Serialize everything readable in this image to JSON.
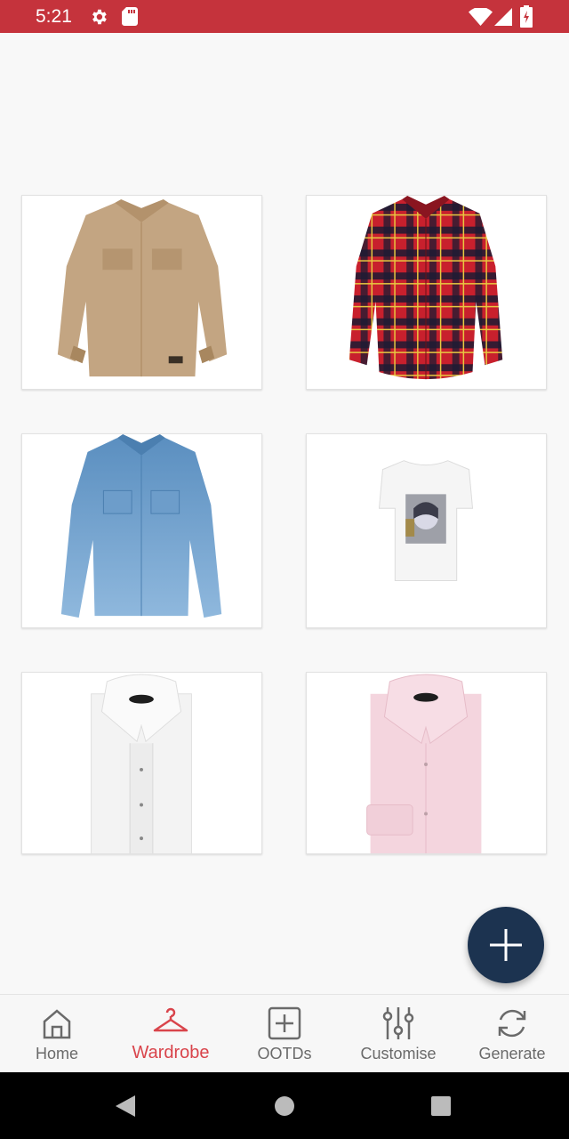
{
  "status_bar": {
    "time": "5:21",
    "icons": [
      "settings-icon",
      "sd-card-icon",
      "wifi-icon",
      "signal-icon",
      "battery-icon"
    ],
    "color": "#c5333c"
  },
  "wardrobe": {
    "items": [
      {
        "name": "tan-suede-western-shirt"
      },
      {
        "name": "red-plaid-flannel-shirt"
      },
      {
        "name": "denim-western-shirt"
      },
      {
        "name": "white-graphic-tshirt"
      },
      {
        "name": "white-tuxedo-dress-shirt"
      },
      {
        "name": "pink-dress-shirt"
      }
    ]
  },
  "fab": {
    "icon": "plus-icon",
    "color": "#1c3350"
  },
  "bottom_nav": {
    "items": [
      {
        "label": "Home",
        "icon": "home-icon",
        "active": false
      },
      {
        "label": "Wardrobe",
        "icon": "hanger-icon",
        "active": true
      },
      {
        "label": "OOTDs",
        "icon": "add-box-icon",
        "active": false
      },
      {
        "label": "Customise",
        "icon": "sliders-icon",
        "active": false
      },
      {
        "label": "Generate",
        "icon": "refresh-icon",
        "active": false
      }
    ],
    "active_color": "#d9444b",
    "inactive_color": "#6a6a6a"
  },
  "system_nav": {
    "buttons": [
      "back-icon",
      "home-circle-icon",
      "recents-icon"
    ]
  }
}
